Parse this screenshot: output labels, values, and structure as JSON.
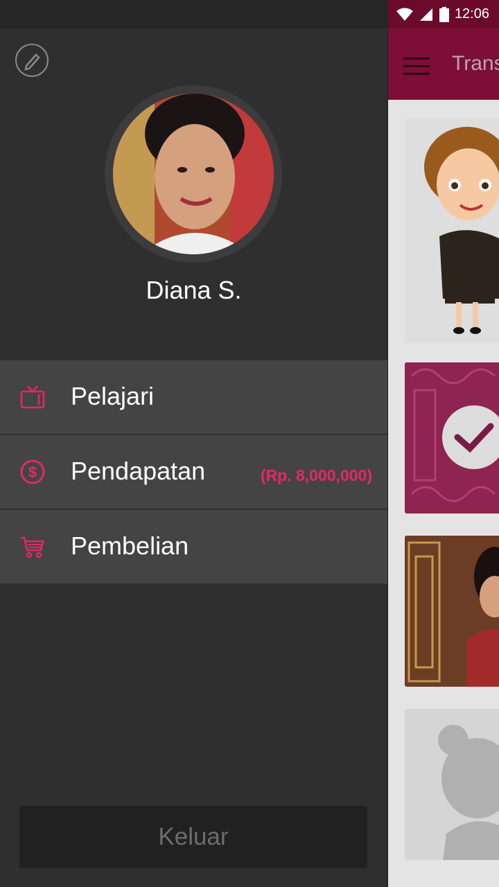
{
  "status_bar": {
    "time": "12:06"
  },
  "background_app": {
    "title": "Trans"
  },
  "drawer": {
    "user_name": "Diana S.",
    "menu": [
      {
        "label": "Pelajari",
        "icon": "tv-icon"
      },
      {
        "label": "Pendapatan",
        "icon": "dollar-circle-icon",
        "extra": "(Rp. 8,000,000)"
      },
      {
        "label": "Pembelian",
        "icon": "cart-icon"
      }
    ],
    "logout_label": "Keluar"
  },
  "colors": {
    "accent": "#e5276a",
    "appbar": "#7d0e35",
    "drawer_bg": "#2f2f2f",
    "menu_bg": "#444444"
  }
}
